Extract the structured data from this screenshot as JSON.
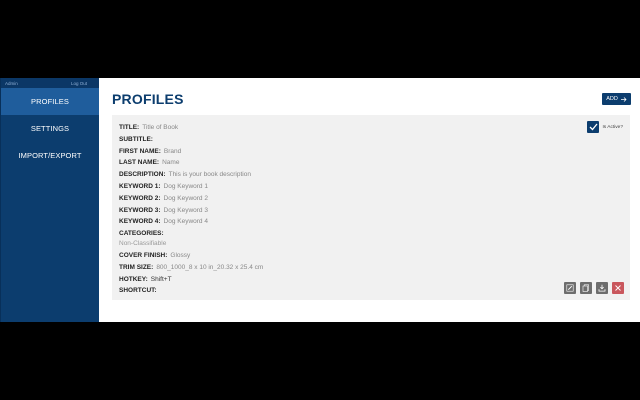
{
  "sidebar": {
    "user": "Admin",
    "logout": "Log Out",
    "items": [
      {
        "label": "PROFILES"
      },
      {
        "label": "SETTINGS"
      },
      {
        "label": "IMPORT/EXPORT"
      }
    ]
  },
  "header": {
    "title": "PROFILES",
    "add_label": "ADD"
  },
  "profile": {
    "title": {
      "label": "TITLE:",
      "value": "Title of Book"
    },
    "subtitle": {
      "label": "SUBTITLE:",
      "value": ""
    },
    "first_name": {
      "label": "FIRST NAME:",
      "value": "Brand"
    },
    "last_name": {
      "label": "LAST NAME:",
      "value": "Name"
    },
    "description": {
      "label": "DESCRIPTION:",
      "value": "This is your book description"
    },
    "keyword1": {
      "label": "KEYWORD 1:",
      "value": "Dog Keyword 1"
    },
    "keyword2": {
      "label": "KEYWORD 2:",
      "value": "Dog Keyword 2"
    },
    "keyword3": {
      "label": "KEYWORD 3:",
      "value": "Dog Keyword 3"
    },
    "keyword4": {
      "label": "KEYWORD 4:",
      "value": "Dog Keyword 4"
    },
    "categories": {
      "label": "CATEGORIES:",
      "value": "Non-Classifiable"
    },
    "cover_finish": {
      "label": "COVER FINISH:",
      "value": "Glossy"
    },
    "trim_size": {
      "label": "TRIM SIZE:",
      "value": "800_1000_8 x 10 in_20.32 x 25.4 cm"
    },
    "hotkey": {
      "label": "HOTKEY:",
      "value": "Shift+T"
    },
    "shortcut": {
      "label": "SHORTCUT:",
      "value": ""
    },
    "is_active_label": "Is Active?",
    "is_active": true
  },
  "icons": {
    "edit": "edit-icon",
    "copy": "copy-icon",
    "download": "download-icon",
    "delete": "close-icon",
    "add_arrow": "arrow-right-icon",
    "check": "check-icon"
  },
  "colors": {
    "brand": "#0c3d6e",
    "sidebar_active": "#1f5d9c",
    "card_bg": "#f1f1f1",
    "delete": "#c9575d",
    "action": "#6d6d6d"
  }
}
